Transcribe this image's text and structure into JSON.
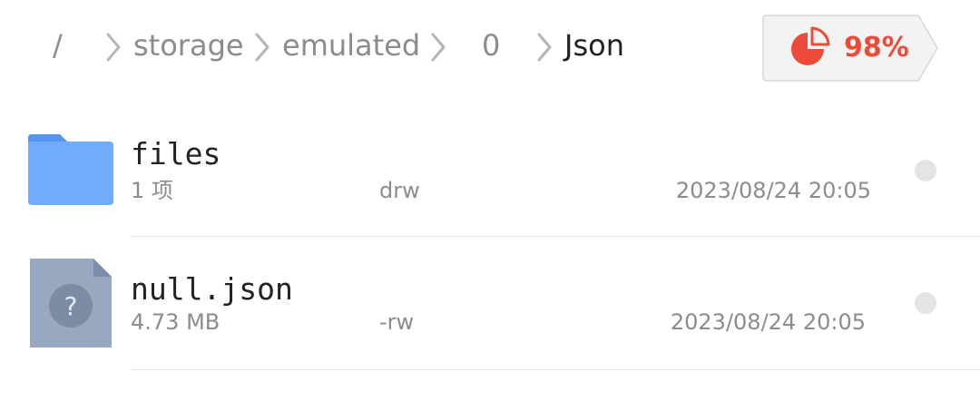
{
  "breadcrumb": {
    "root": "/",
    "segments": [
      "storage",
      "emulated",
      "0"
    ],
    "current": "Json"
  },
  "storage": {
    "percent_label": "98%",
    "used_fraction": 0.98,
    "icon": "pie-chart-icon",
    "color": "#ec4b3a"
  },
  "files": [
    {
      "name": "files",
      "icon": "folder-icon",
      "info": "1 项",
      "permissions": "drw",
      "modified": "2023/08/24 20:05"
    },
    {
      "name": "null.json",
      "icon": "unknown-file-icon",
      "info": "4.73 MB",
      "permissions": "-rw",
      "modified": "2023/08/24 20:05"
    }
  ],
  "colors": {
    "folder": "#70acfb",
    "unknown_file": "#98a8c0",
    "accent": "#ec4b3a"
  }
}
